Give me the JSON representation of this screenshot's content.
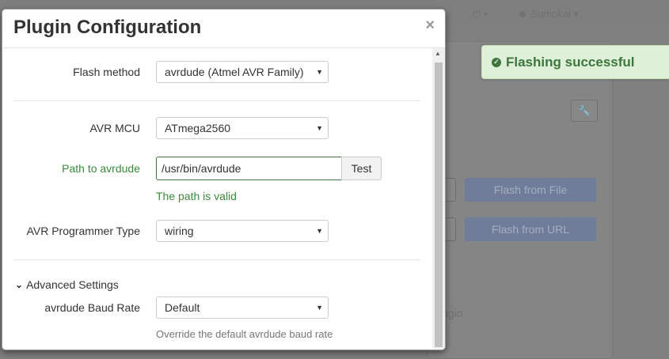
{
  "background": {
    "nav_power_label": "⏻ ▾",
    "nav_user": "Sumokai",
    "buttons": [
      "Flash from File",
      "Flash from URL"
    ],
    "cut_text": "lugin"
  },
  "modal": {
    "title": "Plugin Configuration",
    "close_label": "×",
    "fields": {
      "flash_method": {
        "label": "Flash method",
        "value": "avrdude (Atmel AVR Family)"
      },
      "avr_mcu": {
        "label": "AVR MCU",
        "value": "ATmega2560"
      },
      "path": {
        "label": "Path to avrdude",
        "value": "/usr/bin/avrdude",
        "button": "Test",
        "help": "The path is valid"
      },
      "programmer_type": {
        "label": "AVR Programmer Type",
        "value": "wiring"
      },
      "advanced_toggle": "Advanced Settings",
      "baud_rate": {
        "label": "avrdude Baud Rate",
        "value": "Default"
      },
      "cut_help": "Override the default avrdude baud rate"
    }
  },
  "toast": {
    "message": "Flashing successful"
  },
  "colors": {
    "success": "#3c763d",
    "toast_bg": "#dff0d8",
    "primary_dim": "#707d9a"
  },
  "icons": {
    "close": "close-icon",
    "check": "check-circle-icon",
    "wrench": "wrench-icon",
    "chevron": "chevron-down-icon",
    "caret": "caret-down-icon"
  }
}
